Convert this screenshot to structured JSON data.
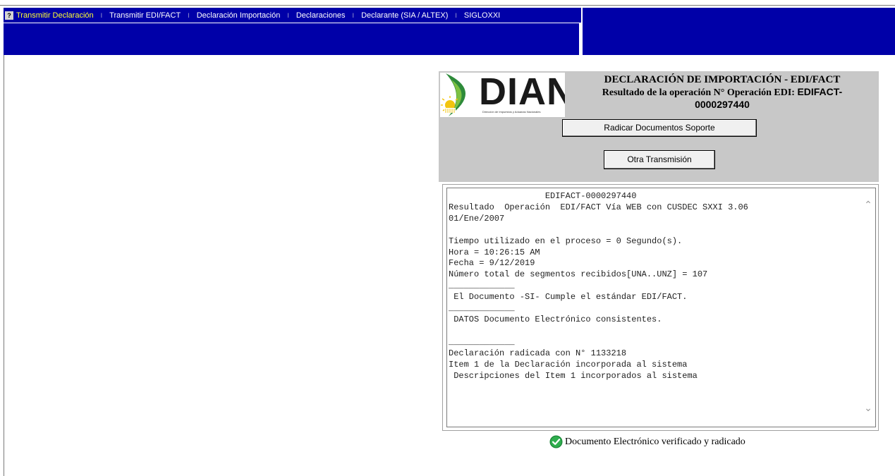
{
  "menu": {
    "help_icon": "?",
    "items": [
      {
        "label": "Transmitir Declaración",
        "active": true
      },
      {
        "label": "Transmitir EDI/FACT",
        "active": false
      },
      {
        "label": "Declaración Importación",
        "active": false
      },
      {
        "label": "Declaraciones",
        "active": false
      },
      {
        "label": "Declarante (SIA / ALTEX)",
        "active": false
      },
      {
        "label": "SIGLOXXI",
        "active": false
      }
    ],
    "separator": "I"
  },
  "colors": {
    "menu_bg": "#0000a8",
    "active_menu": "#ffff33",
    "panel_bg": "#c8c8c8",
    "success": "#1e8a3a"
  },
  "logo": {
    "text": "DIAN",
    "subtitle": "Dirección de Impuestos y Aduanas Nacionales"
  },
  "header": {
    "title": "DECLARACIÓN DE IMPORTACIÓN - EDI/FACT",
    "subtitle": "Resultado de la operación  N° Operación EDI:",
    "operation_id_part1": "EDIFACT-",
    "operation_id_part2": "0000297440"
  },
  "buttons": {
    "radicar": "Radicar Documentos Soporte",
    "otra": "Otra Transmisión"
  },
  "result_text": "                   EDIFACT-0000297440\nResultado  Operación  EDI/FACT Vía WEB con CUSDEC SXXI 3.06\n01/Ene/2007\n\nTiempo utilizado en el proceso = 0 Segundo(s).\nHora = 10:26:15 AM\nFecha = 9/12/2019\nNúmero total de segmentos recibidos[UNA..UNZ] = 107\n_____________\n El Documento -SI- Cumple el estándar EDI/FACT.\n_____________\n DATOS Documento Electrónico consistentes.\n\n_____________\nDeclaración radicada con N° 1133218\nItem 1 de la Declaración incorporada al sistema\n Descripciones del Item 1 incorporados al sistema",
  "status": {
    "icon": "check-circle-icon",
    "text": "Documento Electrónico verificado y radicado"
  }
}
